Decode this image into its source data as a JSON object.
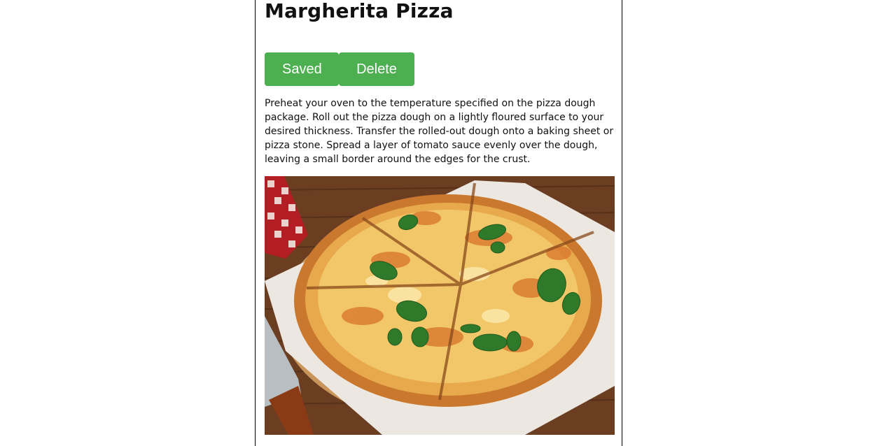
{
  "recipe": {
    "title": "Margherita Pizza",
    "saved_label": "Saved",
    "delete_label": "Delete",
    "description": "Preheat your oven to the temperature specified on the pizza dough package. Roll out the pizza dough on a lightly floured surface to your desired thickness. Transfer the rolled-out dough onto a baking sheet or pizza stone. Spread a layer of tomato sauce evenly over the dough, leaving a small border around the edges for the crust."
  },
  "colors": {
    "button": "#4caf50",
    "button_text": "#ffffff",
    "text": "#111111"
  }
}
